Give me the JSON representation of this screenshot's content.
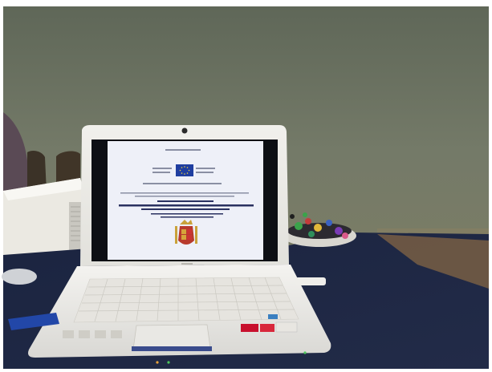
{
  "scene": {
    "title": "",
    "objects": [
      "laptop",
      "laptop-screen-document",
      "eu-flag",
      "coat-of-arms",
      "projector",
      "chair",
      "person",
      "table",
      "candy-bowl",
      "usb-stick",
      "mouse",
      "wall"
    ]
  },
  "colors": {
    "wall": "#6f7566",
    "table": "#1c2540",
    "laptop": "#eceae6",
    "screen": "#eef0f8",
    "eu_blue": "#1f3ea0",
    "coat_red": "#b83a2c"
  }
}
